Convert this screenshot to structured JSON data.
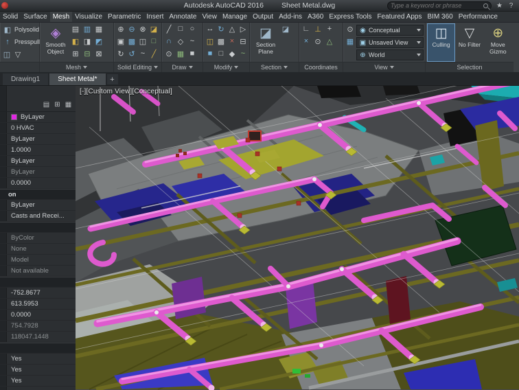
{
  "titlebar": {
    "app": "Autodesk AutoCAD 2016",
    "doc": "Sheet Metal.dwg",
    "search_placeholder": "Type a keyword or phrase",
    "icons": [
      {
        "g": "★",
        "c": "#b9bcbf"
      },
      {
        "g": "?",
        "c": "#b9bcbf"
      }
    ]
  },
  "tabs": [
    "Solid",
    "Surface",
    "Mesh",
    "Visualize",
    "Parametric",
    "Insert",
    "Annotate",
    "View",
    "Manage",
    "Output",
    "Add-ins",
    "A360",
    "Express Tools",
    "Featured Apps",
    "BIM 360",
    "Performance"
  ],
  "active_tab": "Mesh",
  "ribbon": {
    "polysolid": "Polysolid",
    "presspull": "Presspull",
    "smooth_object": "Smooth Object",
    "section_plane": "Section Plane",
    "culling": "Culling",
    "no_filter": "No Filter",
    "move_gizmo": "Move Gizmo",
    "visual_style": "Conceptual",
    "view_preset": "Unsaved View",
    "ucs": "World",
    "labels": {
      "mesh": "Mesh",
      "solid_editing": "Solid Editing",
      "draw": "Draw",
      "modify": "Modify",
      "section": "Section",
      "coordinates": "Coordinates",
      "view": "View",
      "selection": "Selection"
    },
    "icons": {
      "polysolid": {
        "g": "◧"
      },
      "presspull": {
        "g": "↑"
      },
      "smooth": {
        "g": "◈"
      },
      "secplane": {
        "g": "◪"
      },
      "culling": {
        "g": "◫"
      },
      "nofilter": {
        "g": "▽"
      },
      "gizmo": {
        "g": "⊕"
      },
      "vs": {
        "g": "◉"
      },
      "vp": {
        "g": "▣"
      },
      "ucs": {
        "g": "⊕"
      },
      "panelA": [
        {
          "g": "◫",
          "c": "#9fb7c9"
        },
        {
          "g": "▽",
          "c": "#c9ccce"
        }
      ],
      "mesh": [
        {
          "g": "▤",
          "c": "#c9ccce"
        },
        {
          "g": "▥",
          "c": "#74aed6"
        },
        {
          "g": "▦",
          "c": "#c9ccce"
        },
        {
          "g": "◧",
          "c": "#d2b04a"
        },
        {
          "g": "◨",
          "c": "#c9ccce"
        },
        {
          "g": "◩",
          "c": "#74aed6"
        },
        {
          "g": "⊞",
          "c": "#c9ccce"
        },
        {
          "g": "⊟",
          "c": "#8cb87a"
        },
        {
          "g": "⊠",
          "c": "#c9ccce"
        }
      ],
      "solid_editing": [
        {
          "g": "⊕",
          "c": "#c9ccce"
        },
        {
          "g": "⊖",
          "c": "#74aed6"
        },
        {
          "g": "⊗",
          "c": "#c9ccce"
        },
        {
          "g": "◪",
          "c": "#d2b04a"
        },
        {
          "g": "▣",
          "c": "#c9ccce"
        },
        {
          "g": "▩",
          "c": "#74aed6"
        },
        {
          "g": "◫",
          "c": "#c9ccce"
        },
        {
          "g": "□",
          "c": "#8cb87a"
        },
        {
          "g": "↻",
          "c": "#c9ccce"
        },
        {
          "g": "↺",
          "c": "#74aed6"
        },
        {
          "g": "~",
          "c": "#c9ccce"
        },
        {
          "g": "╱",
          "c": "#d2b04a"
        }
      ],
      "draw": [
        {
          "g": "╱",
          "c": "#c9ccce"
        },
        {
          "g": "□",
          "c": "#c9ccce"
        },
        {
          "g": "○",
          "c": "#c9ccce"
        },
        {
          "g": "∩",
          "c": "#74aed6"
        },
        {
          "g": "◇",
          "c": "#c9ccce"
        },
        {
          "g": "~",
          "c": "#c9ccce"
        },
        {
          "g": "⊙",
          "c": "#c9ccce"
        },
        {
          "g": "▦",
          "c": "#8cb87a"
        },
        {
          "g": "■",
          "c": "#c9ccce"
        }
      ],
      "modify": [
        {
          "g": "↔",
          "c": "#c9ccce"
        },
        {
          "g": "↻",
          "c": "#74aed6"
        },
        {
          "g": "△",
          "c": "#c9ccce"
        },
        {
          "g": "▷",
          "c": "#c9ccce"
        },
        {
          "g": "◫",
          "c": "#d2b04a"
        },
        {
          "g": "▩",
          "c": "#c9ccce"
        },
        {
          "g": "×",
          "c": "#c66a5a"
        },
        {
          "g": "⊟",
          "c": "#c9ccce"
        },
        {
          "g": "■",
          "c": "#74aed6"
        },
        {
          "g": "□",
          "c": "#c9ccce"
        },
        {
          "g": "◆",
          "c": "#c9ccce"
        },
        {
          "g": "~",
          "c": "#8cb87a"
        }
      ],
      "section_side": [
        {
          "g": "◪",
          "c": "#9fb7c9"
        }
      ],
      "coordinates": [
        {
          "g": "∟",
          "c": "#c9ccce"
        },
        {
          "g": "⊥",
          "c": "#d2b04a"
        },
        {
          "g": "+",
          "c": "#c9ccce"
        },
        {
          "g": "×",
          "c": "#74aed6"
        },
        {
          "g": "⊙",
          "c": "#c9ccce"
        },
        {
          "g": "△",
          "c": "#8cb87a"
        }
      ],
      "view_side": [
        {
          "g": "⊙",
          "c": "#c9ccce"
        },
        {
          "g": "▦",
          "c": "#74aed6"
        }
      ]
    }
  },
  "filetabs": {
    "t1": "Drawing1",
    "t2": "Sheet Metal*",
    "add": "+"
  },
  "props": {
    "header_icons": [
      {
        "g": "▤",
        "c": "#b9bcbf"
      },
      {
        "g": "⊞",
        "c": "#b9bcbf"
      },
      {
        "g": "▦",
        "c": "#b9bcbf"
      }
    ],
    "rows": [
      {
        "kind": "swatch",
        "value": "ByLayer",
        "swatch": "#e227e2"
      },
      {
        "kind": "value",
        "value": "0 HVAC"
      },
      {
        "kind": "value",
        "value": "ByLayer"
      },
      {
        "kind": "value",
        "value": "1.0000"
      },
      {
        "kind": "value",
        "value": "ByLayer"
      },
      {
        "kind": "dim",
        "value": "ByLayer"
      },
      {
        "kind": "value",
        "value": "0.0000"
      },
      {
        "kind": "header",
        "value": "on"
      },
      {
        "kind": "value",
        "value": "ByLayer"
      },
      {
        "kind": "value",
        "value": "Casts and Recei..."
      },
      {
        "kind": "header",
        "value": ""
      },
      {
        "kind": "dim",
        "value": "ByColor"
      },
      {
        "kind": "dim",
        "value": "None"
      },
      {
        "kind": "dim",
        "value": "Model"
      },
      {
        "kind": "dim",
        "value": "Not available"
      },
      {
        "kind": "header",
        "value": ""
      },
      {
        "kind": "value",
        "value": "-752.8677"
      },
      {
        "kind": "value",
        "value": "613.5953"
      },
      {
        "kind": "value",
        "value": "0.0000"
      },
      {
        "kind": "dim",
        "value": "754.7928"
      },
      {
        "kind": "dim",
        "value": "118047.1448"
      },
      {
        "kind": "header",
        "value": ""
      },
      {
        "kind": "value",
        "value": "Yes"
      },
      {
        "kind": "value",
        "value": "Yes"
      },
      {
        "kind": "value",
        "value": "Yes"
      }
    ]
  },
  "viewport": {
    "controls": "[-][Custom View][Conceptual]"
  },
  "colors": {
    "selection_highlight": "#39536b",
    "duct_magenta": "#de5ace",
    "layer_swatch": "#e227e2",
    "teal_accent": "#1cacb0"
  }
}
